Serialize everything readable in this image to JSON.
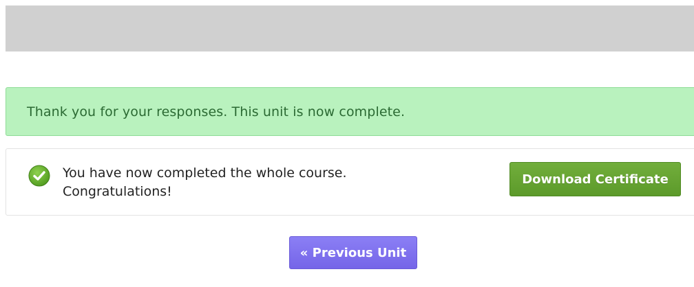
{
  "alert": {
    "message": "Thank you for your responses. This unit is now complete."
  },
  "course_complete": {
    "icon": "checkmark-circle-icon",
    "line1": "You have now completed the whole course.",
    "line2": "Congratulations!",
    "download_label": "Download Certificate"
  },
  "navigation": {
    "previous_label": "« Previous Unit"
  },
  "colors": {
    "alert_bg": "#b9f2be",
    "alert_text": "#2b6a33",
    "download_button": "#66a433",
    "previous_button": "#7f72ee",
    "header_bar": "#d0d0d0"
  }
}
